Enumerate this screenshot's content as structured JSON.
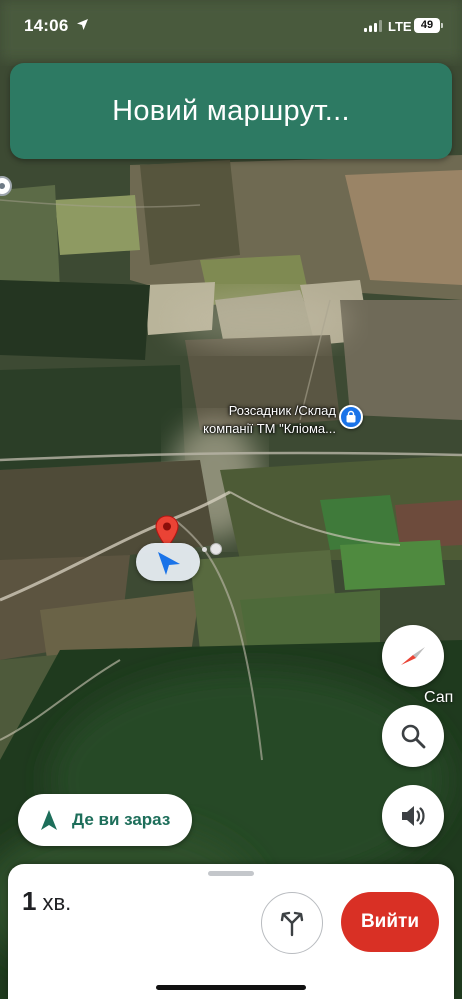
{
  "status_bar": {
    "time": "14:06",
    "network": "LTE",
    "battery": "49"
  },
  "banner": {
    "text": "Новий маршрут..."
  },
  "map": {
    "place_label_line1": "Розсадник /Склад",
    "place_label_line2": "компанії ТМ \"Кліома...",
    "edge_label": "Сап",
    "colors": {
      "route_banner": "#2d7a63",
      "destination_pin": "#ea4335",
      "nav_arrow": "#1a73e8",
      "place_pin": "#1a73e8"
    }
  },
  "controls": {
    "compass_icon": "compass-icon",
    "search_icon": "search-icon",
    "sound_icon": "speaker-icon"
  },
  "where_am_i": {
    "label": "Де ви зараз",
    "icon": "navigation-arrow-icon"
  },
  "bottom_sheet": {
    "eta_value": "1",
    "eta_unit": "хв.",
    "alt_routes_icon": "alternate-routes-icon",
    "exit_label": "Вийти",
    "exit_color": "#d93025"
  }
}
